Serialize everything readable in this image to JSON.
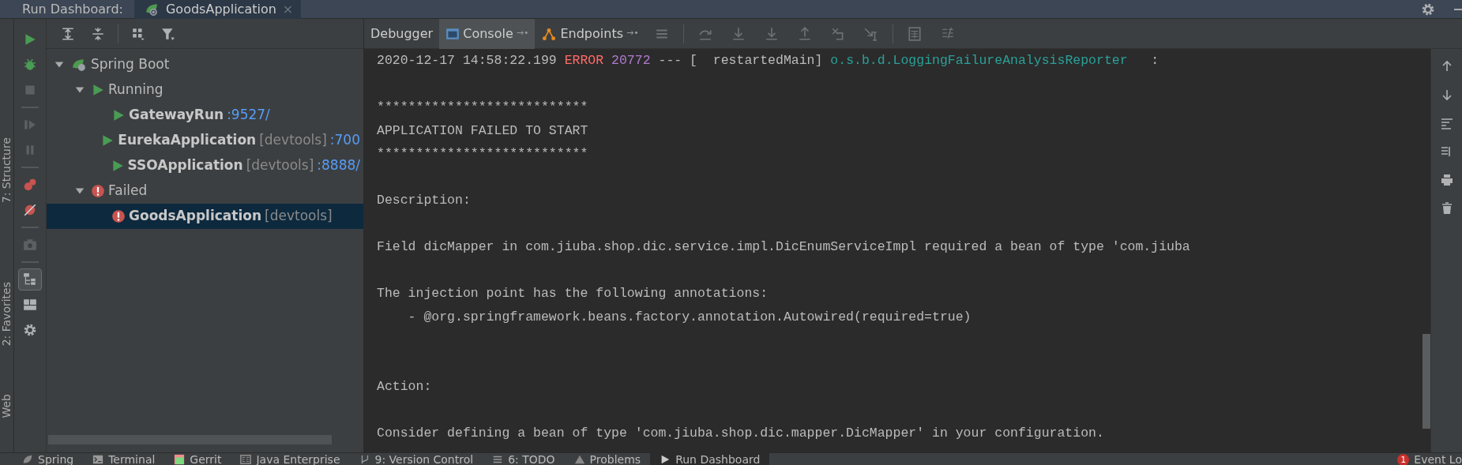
{
  "header": {
    "label": "Run Dashboard:",
    "tabs": [
      {
        "label": "GoodsApplication",
        "close": "×",
        "selected": true
      }
    ]
  },
  "side_labels": [
    "7: Structure",
    "2: Favorites",
    "Web"
  ],
  "left_toolbar": [
    {
      "kind": "run",
      "disabled": false,
      "on": false
    },
    {
      "kind": "debug",
      "disabled": false,
      "on": false
    },
    {
      "kind": "stop",
      "disabled": true,
      "on": false
    },
    {
      "kind": "sep"
    },
    {
      "kind": "resume",
      "disabled": true,
      "on": false
    },
    {
      "kind": "pause",
      "disabled": true,
      "on": false
    },
    {
      "kind": "sep"
    },
    {
      "kind": "breakpoints",
      "disabled": false,
      "on": false
    },
    {
      "kind": "mute",
      "disabled": false,
      "on": false
    },
    {
      "kind": "sep"
    },
    {
      "kind": "camera",
      "disabled": true,
      "on": false
    },
    {
      "kind": "sep"
    },
    {
      "kind": "treegroup",
      "disabled": false,
      "on": true
    },
    {
      "kind": "layout",
      "disabled": false,
      "on": false
    },
    {
      "kind": "gear",
      "disabled": false,
      "on": false
    }
  ],
  "tree_toolbar": [
    {
      "kind": "expand"
    },
    {
      "kind": "collapse"
    },
    {
      "kind": "sep"
    },
    {
      "kind": "group"
    },
    {
      "kind": "filter"
    }
  ],
  "tree": [
    {
      "label": "Spring Boot",
      "kind": "spring",
      "expanded": true,
      "selected": false,
      "children": [
        {
          "label": "Running",
          "kind": "running",
          "expanded": true,
          "selected": false,
          "children": [
            {
              "label": "GatewayRun",
              "kind": "running",
              "selected": false,
              "url": ":9527/"
            },
            {
              "label": "EurekaApplication",
              "kind": "running",
              "selected": false,
              "tag": "[devtools]",
              "url": ":700"
            },
            {
              "label": "SSOApplication",
              "kind": "running",
              "selected": false,
              "tag": "[devtools]",
              "url": ":8888/"
            }
          ]
        },
        {
          "label": "Failed",
          "kind": "failed",
          "expanded": true,
          "selected": false,
          "children": [
            {
              "label": "GoodsApplication",
              "kind": "failed",
              "selected": true,
              "tag": "[devtools]"
            }
          ]
        }
      ]
    }
  ],
  "console_tabs": [
    {
      "label": "Debugger",
      "kind": "debugger",
      "selected": false
    },
    {
      "label": "Console",
      "kind": "console",
      "selected": true,
      "pin": "→•"
    },
    {
      "label": "Endpoints",
      "kind": "endpoints",
      "selected": false,
      "pin": "→•"
    }
  ],
  "console_toolbar": [
    {
      "kind": "menu"
    },
    {
      "kind": "sep"
    },
    {
      "kind": "stepover"
    },
    {
      "kind": "stepinto"
    },
    {
      "kind": "stepinto"
    },
    {
      "kind": "stepout"
    },
    {
      "kind": "drop"
    },
    {
      "kind": "cursor"
    },
    {
      "kind": "sep"
    },
    {
      "kind": "calc"
    },
    {
      "kind": "trace"
    }
  ],
  "console_lines": [
    {
      "kind": "log",
      "segments": [
        {
          "kind": "plain",
          "text": "2020-12-17 14:58:22.199 "
        },
        {
          "kind": "level",
          "text": "ERROR"
        },
        {
          "kind": "pid",
          "text": " 20772"
        },
        {
          "kind": "plain",
          "text": " --- [  restartedMain] "
        },
        {
          "kind": "logger",
          "text": "o.s.b.d.LoggingFailureAnalysisReporter"
        },
        {
          "kind": "plain",
          "text": "   :"
        }
      ]
    },
    {
      "kind": "blank"
    },
    {
      "kind": "text",
      "text": "***************************"
    },
    {
      "kind": "text",
      "text": "APPLICATION FAILED TO START"
    },
    {
      "kind": "text",
      "text": "***************************"
    },
    {
      "kind": "blank"
    },
    {
      "kind": "text",
      "text": "Description:"
    },
    {
      "kind": "blank"
    },
    {
      "kind": "text",
      "text": "Field dicMapper in com.jiuba.shop.dic.service.impl.DicEnumServiceImpl required a bean of type 'com.jiuba"
    },
    {
      "kind": "blank"
    },
    {
      "kind": "text",
      "text": "The injection point has the following annotations:"
    },
    {
      "kind": "text",
      "text": "\t- @org.springframework.beans.factory.annotation.Autowired(required=true)"
    },
    {
      "kind": "blank"
    },
    {
      "kind": "blank"
    },
    {
      "kind": "text",
      "text": "Action:"
    },
    {
      "kind": "blank"
    },
    {
      "kind": "text",
      "text": "Consider defining a bean of type 'com.jiuba.shop.dic.mapper.DicMapper' in your configuration."
    }
  ],
  "console_side": [
    {
      "kind": "up"
    },
    {
      "kind": "down"
    },
    {
      "kind": "wrap"
    },
    {
      "kind": "sort"
    },
    {
      "kind": "print"
    },
    {
      "kind": "trash"
    }
  ],
  "bottom_tabs": [
    {
      "label": "Spring",
      "kind": "spring",
      "selected": false
    },
    {
      "label": "Terminal",
      "kind": "terminal",
      "selected": false
    },
    {
      "label": "Gerrit",
      "kind": "gerrit",
      "selected": false
    },
    {
      "label": "Java Enterprise",
      "kind": "ee",
      "selected": false
    },
    {
      "label": "9: Version Control",
      "kind": "vcs",
      "selected": false
    },
    {
      "label": "6: TODO",
      "kind": "todo",
      "selected": false
    },
    {
      "label": "Problems",
      "kind": "problems",
      "selected": false
    },
    {
      "label": "Run Dashboard",
      "kind": "run",
      "selected": true
    }
  ],
  "event_log": {
    "badge": "1",
    "label": "Event Lo"
  }
}
